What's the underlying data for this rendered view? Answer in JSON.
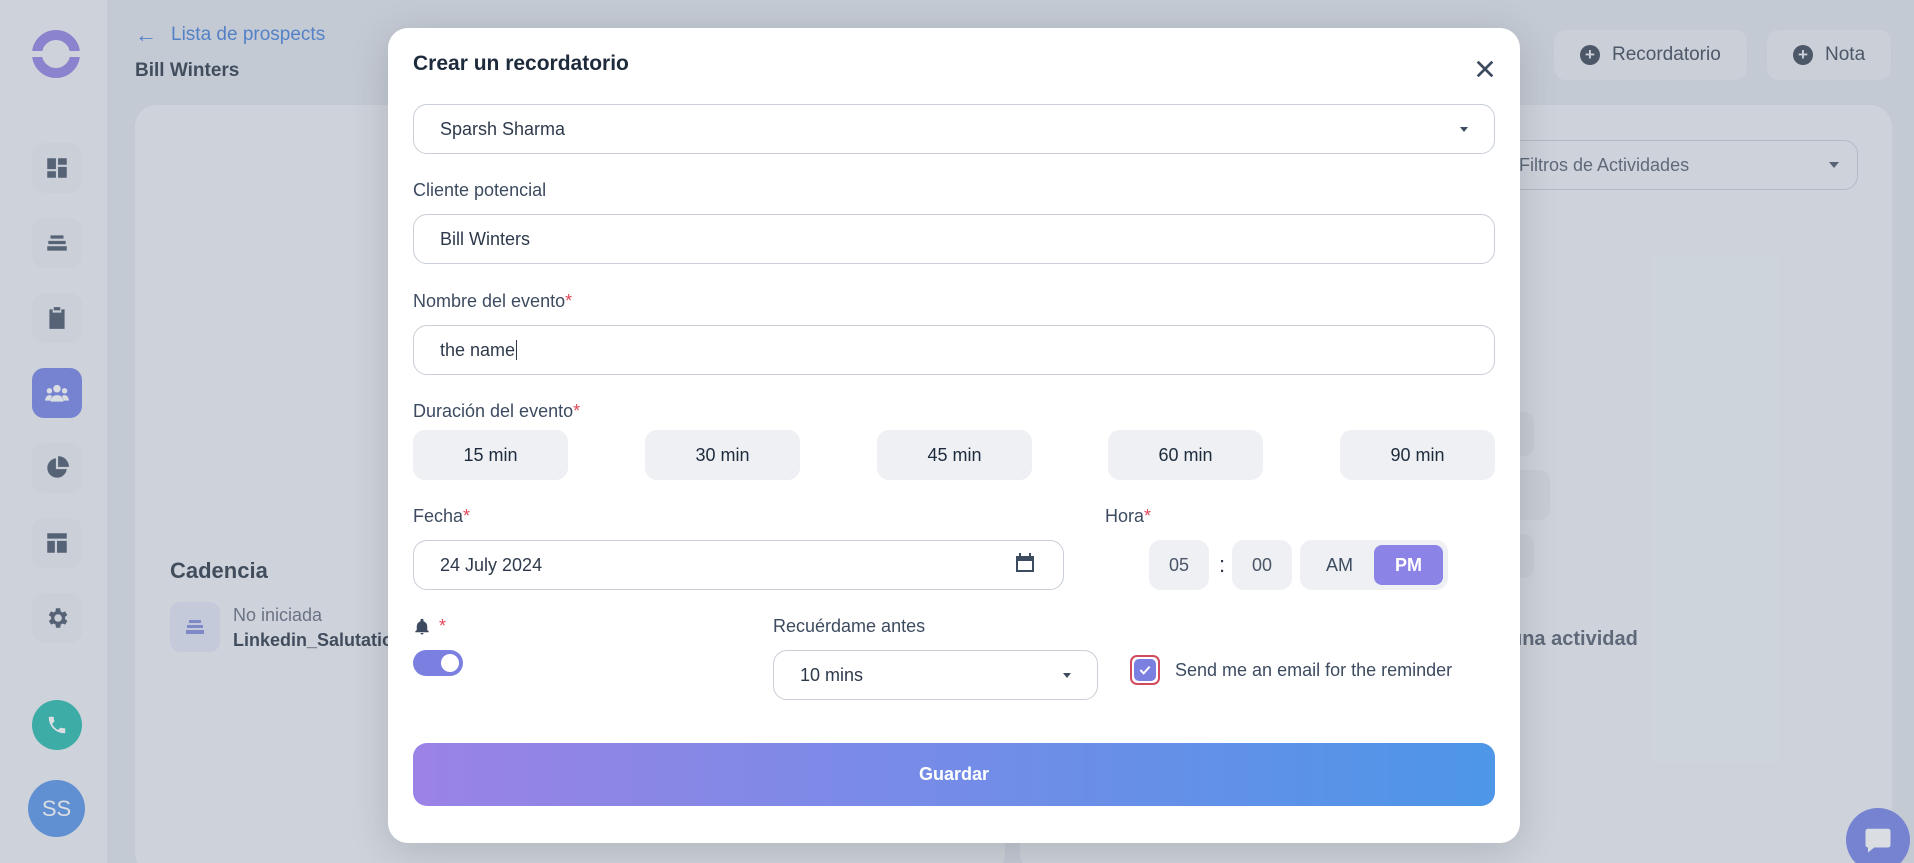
{
  "background": {
    "back_link": "Lista de prospects",
    "prospect_name": "Bill Winters",
    "top_buttons": [
      "Recordatorio",
      "Nota"
    ],
    "filter_label": "Filtros de Actividades",
    "cadence_title": "Cadencia",
    "cadence_status": "No iniciada",
    "cadence_name": "Linkedin_Salutatio",
    "activity_text": "una actividad",
    "avatar_initials": "SS"
  },
  "modal": {
    "title": "Crear un recordatorio",
    "assignee": "Sparsh Sharma",
    "lead_label": "Cliente potencial",
    "lead_value": "Bill Winters",
    "event_name_label": "Nombre del evento",
    "event_name_value": "the name",
    "duration_label": "Duración del evento",
    "durations": [
      "15 min",
      "30 min",
      "45 min",
      "60 min",
      "90 min"
    ],
    "date_label": "Fecha",
    "date_value": "24 July 2024",
    "time_label": "Hora",
    "hour": "05",
    "minute": "00",
    "am": "AM",
    "pm": "PM",
    "required_mark": "*",
    "remind_label": "Recuérdame antes",
    "remind_value": "10 mins",
    "email_checkbox_label": "Send me an email for the reminder",
    "save_label": "Guardar"
  }
}
